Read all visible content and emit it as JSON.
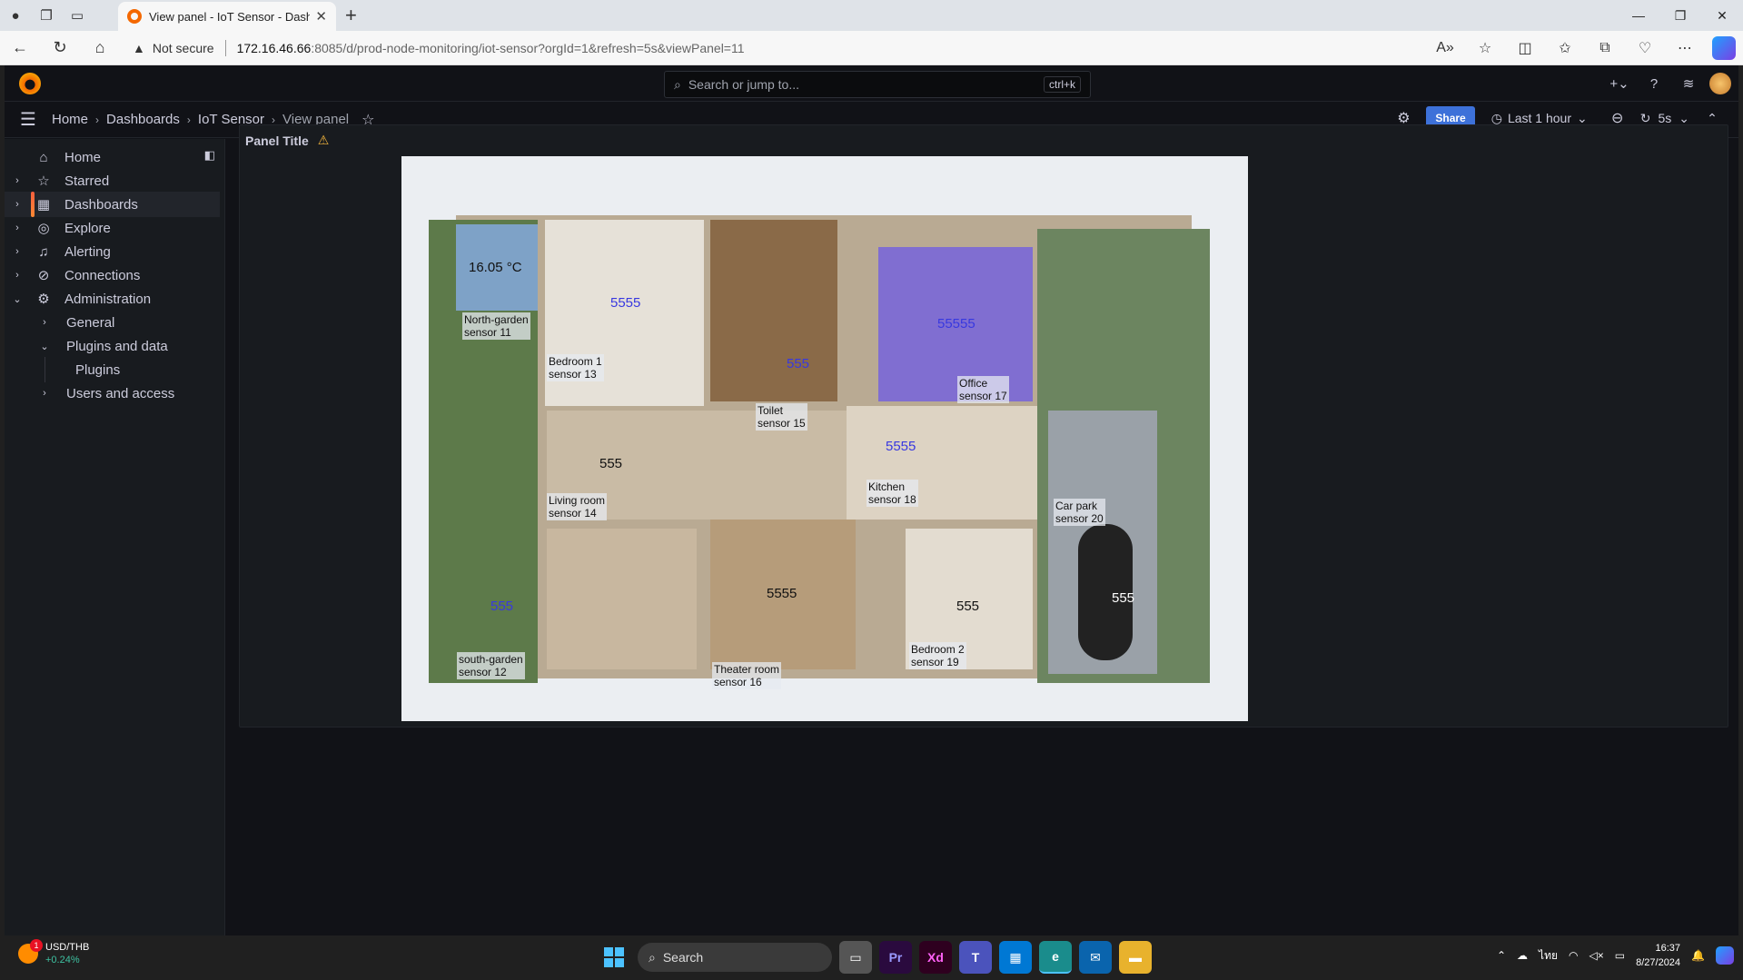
{
  "browser": {
    "tab_title": "View panel - IoT Sensor - Dashbo",
    "url_warning": "Not secure",
    "url_host": "172.16.46.66",
    "url_path": ":8085/d/prod-node-monitoring/iot-sensor?orgId=1&refresh=5s&viewPanel=11"
  },
  "grafana": {
    "search_placeholder": "Search or jump to...",
    "search_shortcut": "ctrl+k",
    "breadcrumbs": [
      "Home",
      "Dashboards",
      "IoT Sensor",
      "View panel"
    ],
    "share_label": "Share",
    "time_range": "Last 1 hour",
    "refresh_interval": "5s"
  },
  "sidebar": {
    "items": [
      {
        "label": "Home",
        "icon": "home-icon",
        "arrow": ""
      },
      {
        "label": "Starred",
        "icon": "star-icon",
        "arrow": "›"
      },
      {
        "label": "Dashboards",
        "icon": "apps-icon",
        "arrow": "›",
        "active": true
      },
      {
        "label": "Explore",
        "icon": "compass-icon",
        "arrow": "›"
      },
      {
        "label": "Alerting",
        "icon": "bell-icon",
        "arrow": "›"
      },
      {
        "label": "Connections",
        "icon": "connections-icon",
        "arrow": "›"
      },
      {
        "label": "Administration",
        "icon": "cog-icon",
        "arrow": "⌄"
      },
      {
        "label": "General",
        "arrow": "›"
      },
      {
        "label": "Plugins and data",
        "arrow": "⌄"
      },
      {
        "label": "Plugins",
        "arrow": ""
      },
      {
        "label": "Users and access",
        "arrow": "›"
      }
    ]
  },
  "panel": {
    "title": "Panel Title",
    "temperature": "16.05 °C",
    "sensors": [
      {
        "label": "North-garden\nsensor 11",
        "value": ""
      },
      {
        "label": "Bedroom 1\nsensor 13",
        "value": "5555",
        "value_color": "#3838e0"
      },
      {
        "label": "Toilet\nsensor 15",
        "value": "555",
        "value_color": "#3838e0"
      },
      {
        "label": "Office\nsensor 17",
        "value": "55555",
        "value_color": "#3838e0"
      },
      {
        "label": "Living room\nsensor 14",
        "value": "555",
        "value_color": "#111111"
      },
      {
        "label": "Kitchen\nsensor 18",
        "value": "5555",
        "value_color": "#3838e0"
      },
      {
        "label": "Car park\nsensor 20",
        "value": "555",
        "value_color": "#111111"
      },
      {
        "label": "south-garden\nsensor 12",
        "value": "555",
        "value_color": "#3838e0"
      },
      {
        "label": "Theater room\nsensor 16",
        "value": "5555",
        "value_color": "#111111"
      },
      {
        "label": "Bedroom 2\nsensor 19",
        "value": "555",
        "value_color": "#111111"
      }
    ]
  },
  "taskbar": {
    "ticker": "USD/THB",
    "ticker_change": "+0.24%",
    "notification_count": "1",
    "search_label": "Search",
    "time": "16:37",
    "date": "8/27/2024"
  }
}
